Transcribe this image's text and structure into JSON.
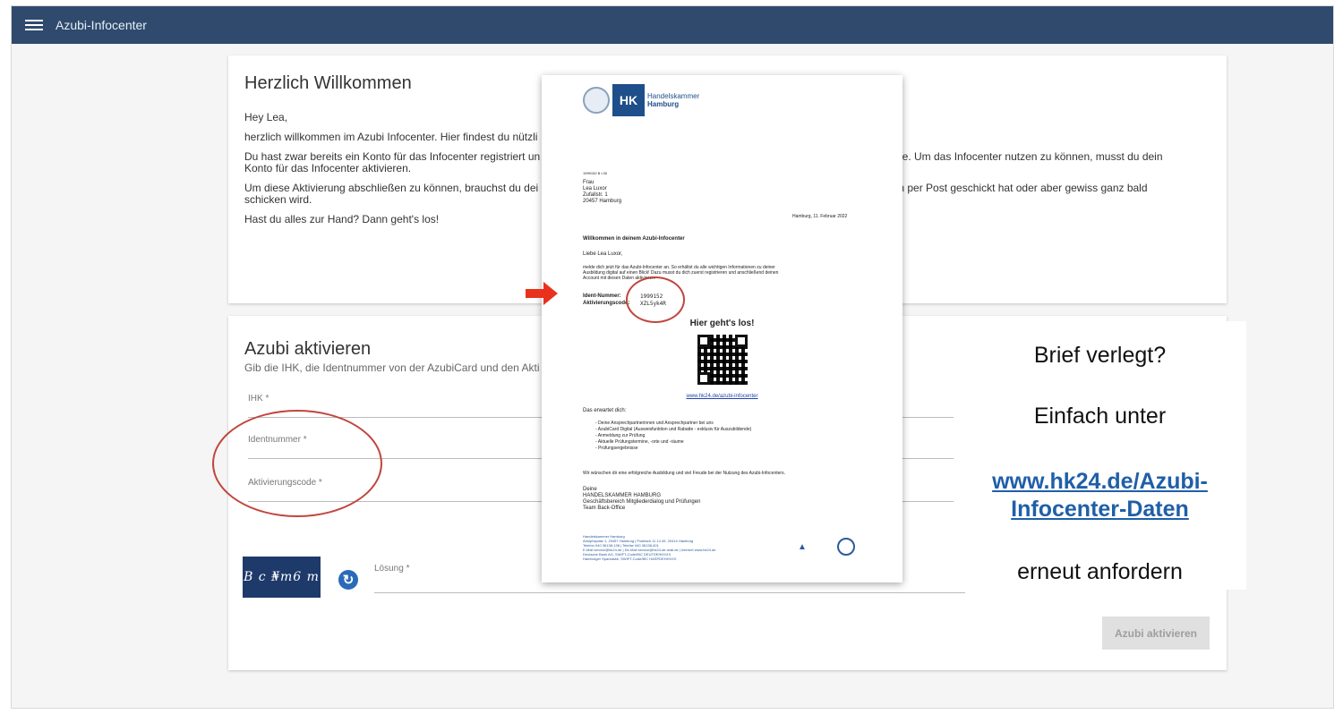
{
  "appbar": {
    "title": "Azubi-Infocenter"
  },
  "welcome": {
    "heading": "Herzlich Willkommen",
    "greeting": "Hey Lea,",
    "p1": "herzlich willkommen im Azubi Infocenter. Hier findest du nützli",
    "p2a": "Du hast zwar bereits ein Konto für das Infocenter registriert un",
    "p2b": "Miete. Um das Infocenter nutzen zu können, musst du dein",
    "p2c": "Konto für das Infocenter aktivieren.",
    "p3a": "Um diese Aktivierung abschließen zu können, brauchst du dei",
    "p3b": "schon per Post geschickt hat oder aber gewiss ganz bald",
    "p3c": "schicken wird.",
    "p4": "Hast du alles zur Hand? Dann geht's los!"
  },
  "activate": {
    "heading": "Azubi aktivieren",
    "subtitle": "Gib die IHK, die Identnummer von der AzubiCard und den Akti",
    "ihk_label": "IHK *",
    "ident_label": "Identnummer *",
    "code_label": "Aktivierungscode *",
    "captcha_text": "B c ₦m6 m",
    "loesung_label": "Lösung *",
    "submit": "Azubi aktivieren"
  },
  "letter": {
    "logo_text": "HK",
    "logo_name1": "Handelskammer",
    "logo_name2": "Hamburg",
    "ref": "1999152   B t.30",
    "addr1": "Frau",
    "addr2": "Lea Luxor",
    "addr3": "Zufallstr. 1",
    "addr4": "20457 Hamburg",
    "date": "Hamburg, 11. Februar 2022",
    "subject": "Willkommen in deinem Azubi-Infocenter",
    "salutation": "Liebe Lea Luxor,",
    "body1a": "melde dich jetzt für das Azubi-Infocenter an. So erhältst du alle wichtigen Informationen zu deiner",
    "body1b": "Ausbildung digital auf einen Blick! Dazu musst du dich zuerst registrieren und anschließend deinen",
    "body1c": "Account mit diesen Daten aktivieren:",
    "ident_label": "Ident-Nummer:",
    "ident_value": "1999152",
    "code_label": "Aktivierungscode:",
    "code_value": "XZL5yk4R",
    "start": "Hier geht's los!",
    "link": "www.hk24.de/azubi-infocenter",
    "expect": "Das erwartet dich:",
    "items": [
      "Deine Ansprechpartnerinnen und Ansprechpartner bei uns",
      "AzubiCard Digital (Ausweisfunktion und Rabatte - exklusiv für Auszubildende)",
      "Anmeldung zur Prüfung",
      "Aktuelle Prüfungstermine, -orte und -räume",
      "Prüfungsergebnisse"
    ],
    "wish": "Wir wünschen dir eine erfolgreiche Ausbildung und viel Freude bei der Nutzung des Azubi-Infocenters.",
    "sign1": "Deine",
    "sign2": "HANDELSKAMMER HAMBURG",
    "sign3": "Geschäftsbereich Mitgliederdialog und Prüfungen",
    "sign4": "Team Back-Office",
    "foot1": "Handelskammer Hamburg",
    "foot2": "Adolphsplatz 1, 20457 Hamburg | Postfach 11 14 49, 20414 Hamburg",
    "foot3": "Telefon 040 36138-138 | Telefax 040 36138-401",
    "foot4": "E-Mail service@hk24.de | De-Mail service@hk24.de-mail.de | Internet www.hk24.de",
    "foot5": "Deutsche Bank AG, SWIFT-Code/BIC DEUTDEHHXXX",
    "foot6": "Hamburger Sparkasse, SWIFT-Code/BIC HASPDEHHXXX"
  },
  "notice": {
    "line1": "Brief verlegt?",
    "line2": "Einfach unter",
    "link1": "www.hk24.de/Azubi-",
    "link2": "Infocenter-Daten",
    "line3": "erneut anfordern",
    "link_color": "#1f5fa8"
  },
  "colors": {
    "appbar": "#2f4a6d",
    "annotation_red": "#c0463e",
    "arrow_red": "#e8321e"
  }
}
